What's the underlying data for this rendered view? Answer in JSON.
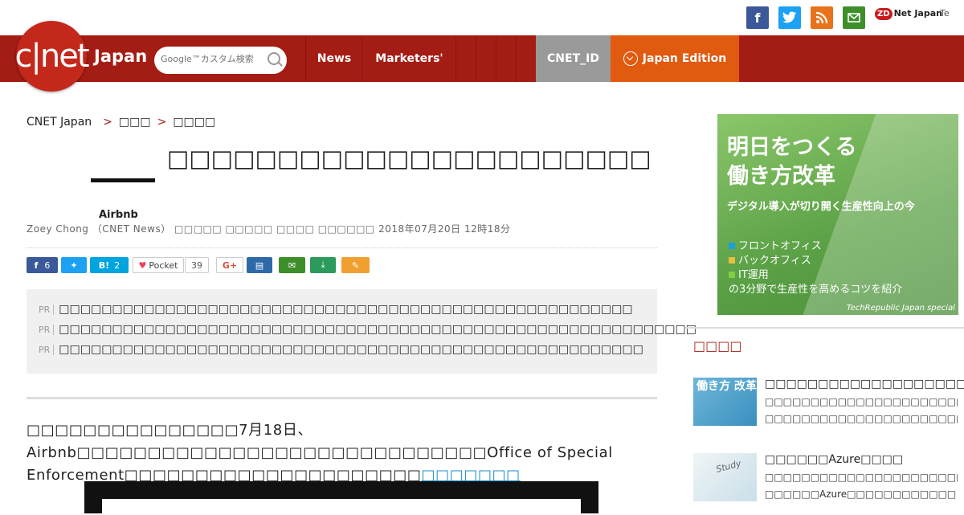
{
  "social": {
    "facebook": "f",
    "twitter": "t",
    "rss": "rss",
    "mail": "mail",
    "zdnet_badge": "ZD",
    "zdnet": "Net Japan",
    "techrepublic": "Te"
  },
  "header": {
    "logo": "c|net",
    "edition_label": "Japan",
    "search_placeholder": "Google™カスタム検索",
    "nav": [
      "News",
      "Marketers'"
    ],
    "cnet_id": "CNET_ID",
    "edition": "Japan Edition"
  },
  "breadcrumb": [
    "CNET Japan",
    "□□□",
    "□□□□"
  ],
  "article": {
    "thumb_text": "Airbnb",
    "title": "□□□□□□□□□□□□□□□□□□□□□□□□□□□□□□□□□□□□□□□□□",
    "byline": "Zoey Chong （CNET News） □□□□□ □□□□□ □□□□ □□□□□□  2018年07月20日 12時18分",
    "body_text": "□□□□□□□□□□□□□□□7月18日、Airbnb□□□□□□□□□□□□□□□□□□□□□□□□□□□□□Office of Special Enforcement□□□□□□□□□□□□□□□□□□□□□",
    "body_link": "□□□□□□□"
  },
  "share": {
    "fb_count": "6",
    "hatena": "B!",
    "hatena_count": "2",
    "pocket": "Pocket",
    "pocket_count": "39",
    "gplus": "G+"
  },
  "pr": {
    "label": "PR",
    "items": [
      "□□□□□□□□□□□□□□□□□□□□□□□□□□□□□□□□□□□□□□□□□□□□□□□□□□□□□□",
      "□□□□□□□□□□□□□□□□□□□□□□□□□□□□□□□□□□□□□□□□□□□□□□□□□□□□□□□□□□□□",
      "□□□□□□□□□□□□□□□□□□□□□□□□□□□□□□□□□□□□□□□□□□□□□□□□□□□□□□□"
    ]
  },
  "sidebar": {
    "ad": {
      "headline1": "明日をつくる",
      "headline2": "働き方改革",
      "sub": "デジタル導入が切り開く生産性向上の今",
      "items": [
        "フロントオフィス",
        "バックオフィス",
        "IT運用"
      ],
      "line4": "の3分野で生産性を高めるコツを紹介",
      "footer": "TechRepublic Japan special"
    },
    "section_title": "□□□□",
    "items": [
      {
        "thumb": "働き方 改革",
        "title": "□□□□□□□□□□□□□□□□□□□□□",
        "desc1": "□□□□□□□□□□□□□□□□□□□□□□□□□□□□□□",
        "desc2": "□□□□□□□□□□□□□□□□□□□□□□□□□□□□□□"
      },
      {
        "thumb": "Study",
        "title": "□□□□□□Azure□□□□",
        "desc1": "□□□□□□□□□□□□□□□□□□□□□□□□□□□□□□",
        "desc2": "□□□□□□Azure□□□□□□□□□□□□"
      }
    ]
  },
  "colors": {
    "nav_bg": "#a41d14",
    "cnet_id_bg": "#9a9a9a",
    "edition_bg": "#e05a10",
    "link": "#1a8fc7"
  }
}
